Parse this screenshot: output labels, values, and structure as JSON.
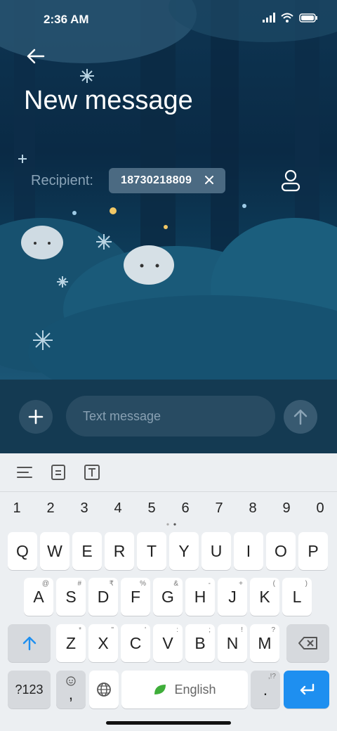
{
  "status_bar": {
    "time": "2:36 AM"
  },
  "header": {
    "title": "New message"
  },
  "recipient": {
    "label": "Recipient:",
    "chip_number": "18730218809"
  },
  "compose": {
    "placeholder": "Text message"
  },
  "keyboard": {
    "numbers": [
      "1",
      "2",
      "3",
      "4",
      "5",
      "6",
      "7",
      "8",
      "9",
      "0"
    ],
    "row1": [
      {
        "k": "Q",
        "h": ""
      },
      {
        "k": "W",
        "h": ""
      },
      {
        "k": "E",
        "h": ""
      },
      {
        "k": "R",
        "h": ""
      },
      {
        "k": "T",
        "h": ""
      },
      {
        "k": "Y",
        "h": ""
      },
      {
        "k": "U",
        "h": ""
      },
      {
        "k": "I",
        "h": ""
      },
      {
        "k": "O",
        "h": ""
      },
      {
        "k": "P",
        "h": ""
      }
    ],
    "row2": [
      {
        "k": "A",
        "h": "@"
      },
      {
        "k": "S",
        "h": "#"
      },
      {
        "k": "D",
        "h": "₹"
      },
      {
        "k": "F",
        "h": "%"
      },
      {
        "k": "G",
        "h": "&"
      },
      {
        "k": "H",
        "h": "-"
      },
      {
        "k": "J",
        "h": "+"
      },
      {
        "k": "K",
        "h": "("
      },
      {
        "k": "L",
        "h": ")"
      }
    ],
    "row3": [
      {
        "k": "Z",
        "h": "*"
      },
      {
        "k": "X",
        "h": "\""
      },
      {
        "k": "C",
        "h": "'"
      },
      {
        "k": "V",
        "h": ":"
      },
      {
        "k": "B",
        "h": ";"
      },
      {
        "k": "N",
        "h": "!"
      },
      {
        "k": "M",
        "h": "?"
      }
    ],
    "symbols_label": "?123",
    "comma_label": ",",
    "space_label": "English",
    "period_label": ".",
    "period_hint": ",!?"
  },
  "colors": {
    "enter_key": "#1e8ff0",
    "shift_arrow": "#1e8ff0",
    "leaf": "#3fae3a"
  }
}
